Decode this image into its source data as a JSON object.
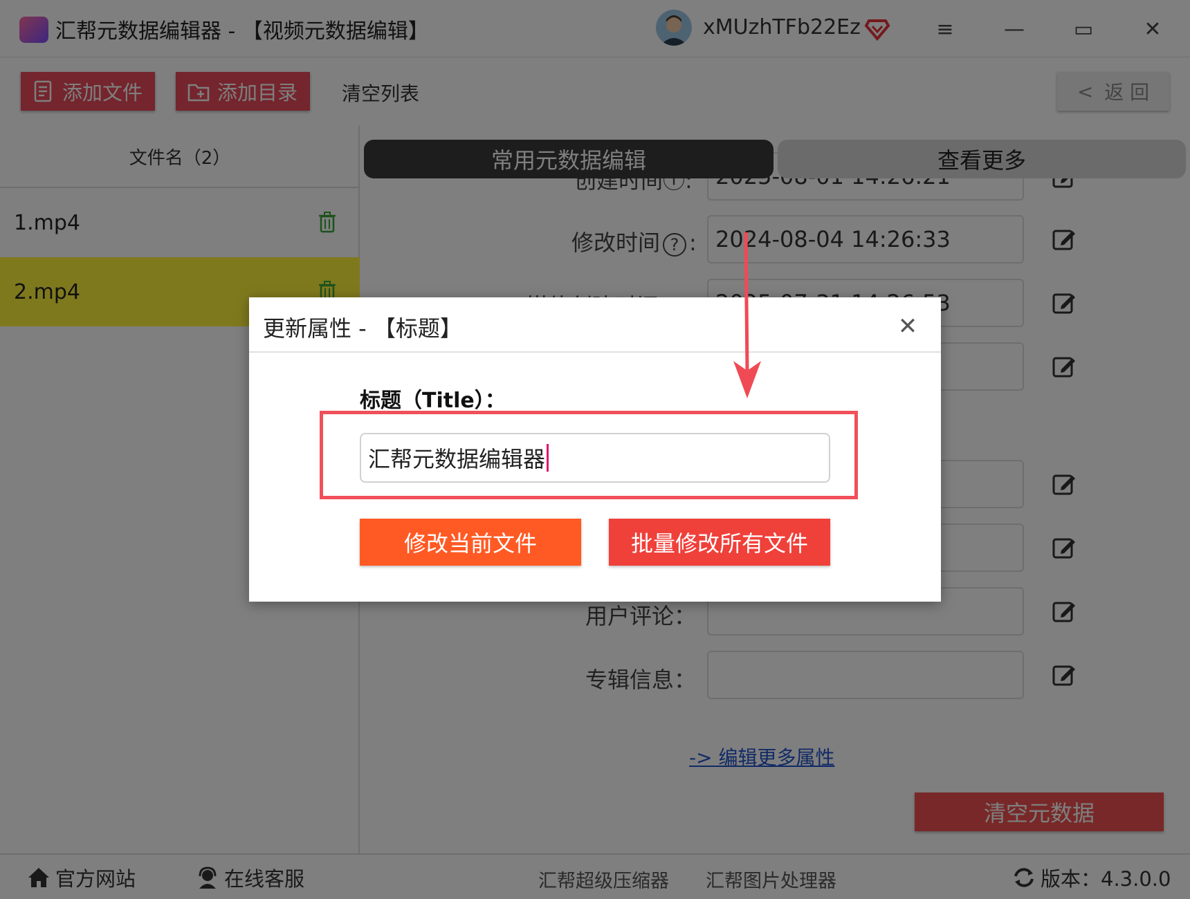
{
  "app": {
    "title": "汇帮元数据编辑器 - 【视频元数据编辑】",
    "username": "xMUzhTFb22Ez"
  },
  "window_controls": {
    "menu": "≡",
    "minimize": "—",
    "maximize": "▭",
    "close": "✕"
  },
  "toolbar": {
    "add_file": "添加文件",
    "add_dir": "添加目录",
    "clear_list": "清空列表",
    "back": "返 回",
    "back_chevron": "<"
  },
  "file_list": {
    "header": "文件名（2）",
    "items": [
      {
        "name": "1.mp4"
      },
      {
        "name": "2.mp4"
      }
    ]
  },
  "tabs": {
    "active": "常用元数据编辑",
    "other": "查看更多"
  },
  "fields": {
    "created_label": "创建时间",
    "created_value": "2025-08-01 14:26:21",
    "modified_label": "修改时间",
    "modified_value": "2024-08-04 14:26:33",
    "media_created_label": "媒体创建时间",
    "media_created_value": "2025-07-31 14:26:53",
    "comment_label": "用户评论：",
    "album_label": "专辑信息："
  },
  "help_icon_glyph": "?",
  "colon": ":",
  "more_link": "-> 编辑更多属性",
  "clear_metadata": "清空元数据",
  "statusbar": {
    "website": "官方网站",
    "support": "在线客服",
    "compressor": "汇帮超级压缩器",
    "image_tool": "汇帮图片处理器",
    "version": "版本：4.3.0.0"
  },
  "dialog": {
    "title": "更新属性 - 【标题】",
    "close": "✕",
    "field_label": "标题（Title）：",
    "field_value": "汇帮元数据编辑器",
    "btn_current": "修改当前文件",
    "btn_all": "批量修改所有文件"
  },
  "colors": {
    "accent": "#e84b5a",
    "selected_row": "#fff33c",
    "dialog_highlight": "#f0505a",
    "btn_current": "#ff5a24",
    "btn_all": "#f0403a"
  }
}
